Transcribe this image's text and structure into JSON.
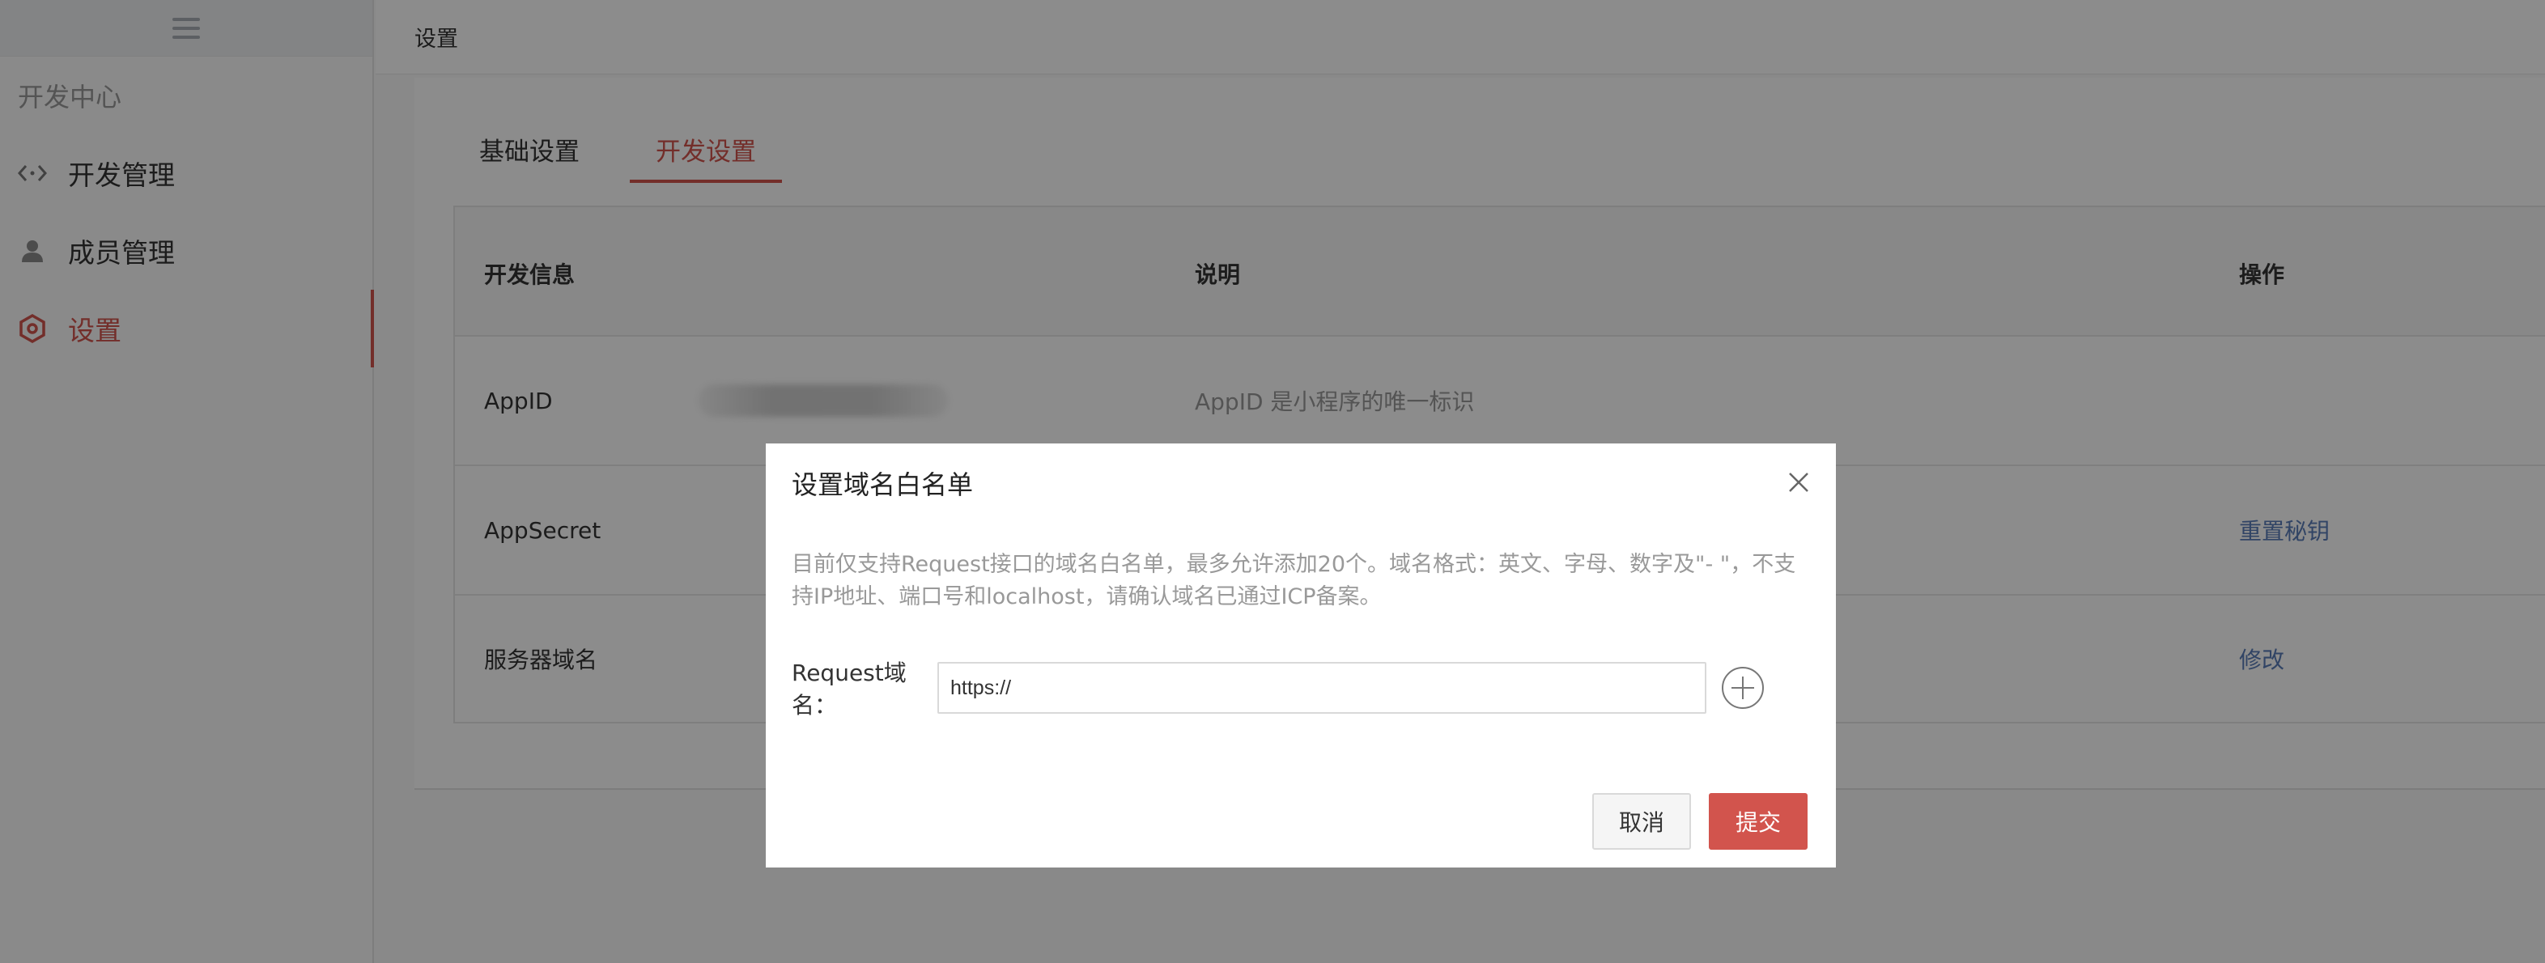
{
  "header": {
    "title": "设置"
  },
  "sidebar": {
    "section_title": "开发中心",
    "items": [
      {
        "label": "开发管理",
        "icon": "code-icon",
        "active": false
      },
      {
        "label": "成员管理",
        "icon": "user-icon",
        "active": false
      },
      {
        "label": "设置",
        "icon": "settings-hexagon-icon",
        "active": true
      }
    ]
  },
  "tabs": [
    {
      "label": "基础设置",
      "active": false
    },
    {
      "label": "开发设置",
      "active": true
    }
  ],
  "table": {
    "headers": [
      "开发信息",
      "说明",
      "操作"
    ],
    "rows": [
      {
        "name": "AppID",
        "value": "",
        "desc": "AppID 是小程序的唯一标识",
        "action": ""
      },
      {
        "name": "AppSecret",
        "value": "",
        "desc": "",
        "action": "重置秘钥"
      },
      {
        "name": "服务器域名",
        "value": "",
        "desc": "",
        "action": "修改"
      }
    ]
  },
  "modal": {
    "title": "设置域名白名单",
    "description": "目前仅支持Request接口的域名白名单，最多允许添加20个。域名格式：英文、字母、数字及\"- \"，不支持IP地址、端口号和localhost，请确认域名已通过ICP备案。",
    "field_label": "Request域名：",
    "field_value": "https://",
    "cancel_label": "取消",
    "submit_label": "提交"
  },
  "colors": {
    "accent": "#d2544d",
    "link": "#5a7db8",
    "overlay": "rgba(0,0,0,0.45)"
  }
}
